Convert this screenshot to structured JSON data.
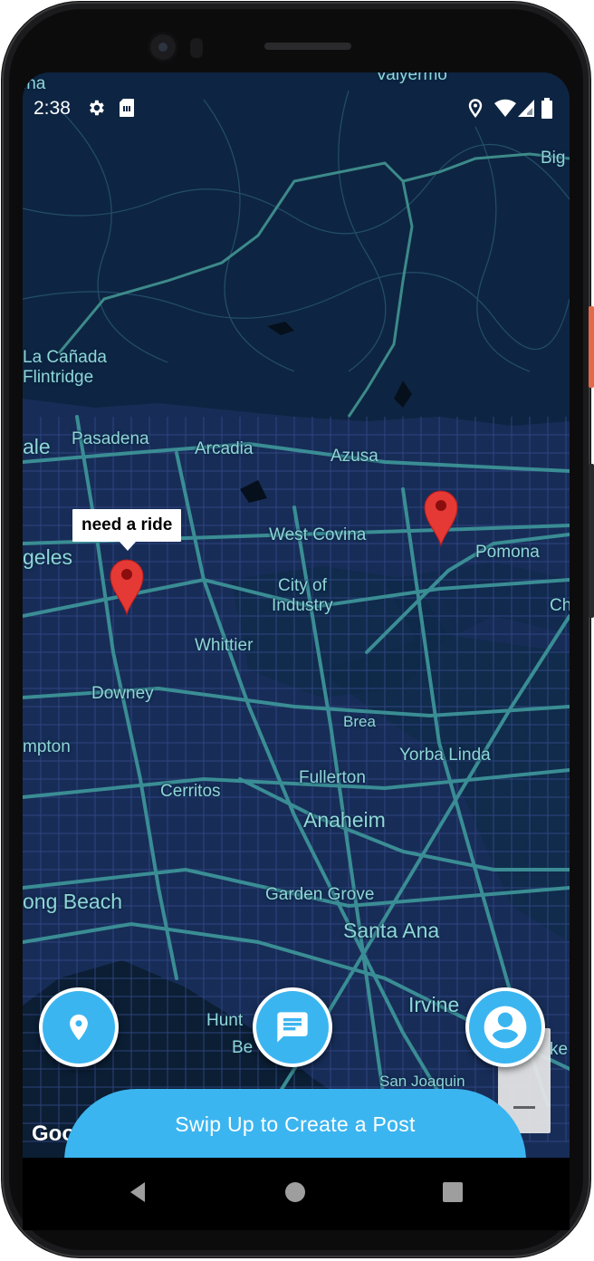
{
  "status_bar": {
    "time": "2:38",
    "icons": [
      "settings-icon",
      "sim-card-icon",
      "location-icon",
      "wifi-icon",
      "signal-icon",
      "battery-icon"
    ]
  },
  "map": {
    "labels": [
      {
        "id": "valyermo",
        "text": "Valyermo"
      },
      {
        "id": "lna",
        "text": "lna"
      },
      {
        "id": "big",
        "text": "Big"
      },
      {
        "id": "la-canada",
        "text": "La Cañada"
      },
      {
        "id": "flintridge",
        "text": "Flintridge"
      },
      {
        "id": "dale",
        "text": "ale"
      },
      {
        "id": "pasadena",
        "text": "Pasadena"
      },
      {
        "id": "arcadia",
        "text": "Arcadia"
      },
      {
        "id": "azusa",
        "text": "Azusa"
      },
      {
        "id": "west-covina",
        "text": "West Covina"
      },
      {
        "id": "pomona",
        "text": "Pomona"
      },
      {
        "id": "angeles",
        "text": "geles"
      },
      {
        "id": "city-of",
        "text": "City of"
      },
      {
        "id": "industry",
        "text": "Industry"
      },
      {
        "id": "ch",
        "text": "Ch"
      },
      {
        "id": "whittier",
        "text": "Whittier"
      },
      {
        "id": "downey",
        "text": "Downey"
      },
      {
        "id": "brea",
        "text": "Brea"
      },
      {
        "id": "compton",
        "text": "mpton"
      },
      {
        "id": "yorba-linda",
        "text": "Yorba Linda"
      },
      {
        "id": "fullerton",
        "text": "Fullerton"
      },
      {
        "id": "cerritos",
        "text": "Cerritos"
      },
      {
        "id": "anaheim",
        "text": "Anaheim"
      },
      {
        "id": "long-beach",
        "text": "ong Beach"
      },
      {
        "id": "garden-grove",
        "text": "Garden Grove"
      },
      {
        "id": "santa-ana",
        "text": "Santa Ana"
      },
      {
        "id": "irvine",
        "text": "Irvine"
      },
      {
        "id": "huntington",
        "text": "Hunt"
      },
      {
        "id": "beach",
        "text": "Be"
      },
      {
        "id": "san-joaquin",
        "text": "San Joaquin"
      },
      {
        "id": "lake",
        "text": "ke"
      }
    ],
    "info_window": "need a ride",
    "attribution": "Goo"
  },
  "actions": {
    "location_button": "location-pin-icon",
    "messages_button": "chat-icon",
    "profile_button": "account-icon"
  },
  "bottom_sheet": {
    "label": "Swip Up to Create a Post"
  },
  "nav_bar": {
    "back": "back-icon",
    "home": "home-icon",
    "recents": "recents-icon"
  },
  "colors": {
    "map_background": "#0d2542",
    "road": "#3a8d94",
    "street": "#3a4f8c",
    "accent": "#3bb5f0",
    "marker": "#e53935"
  }
}
